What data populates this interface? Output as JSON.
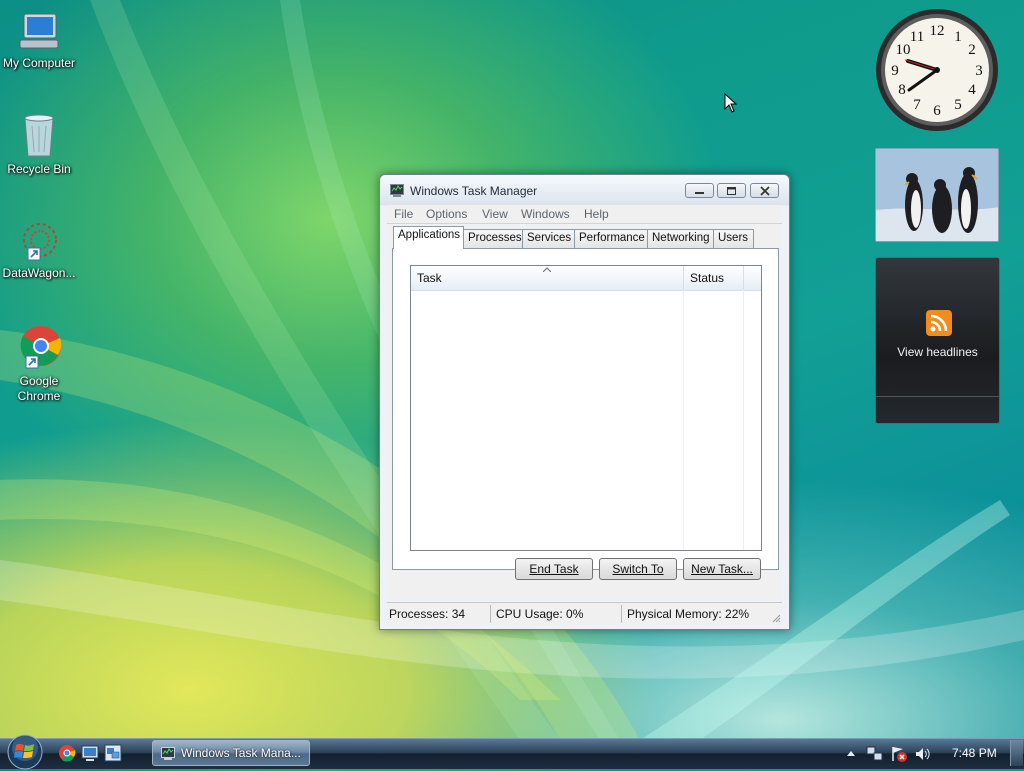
{
  "desktop": {
    "icons": [
      {
        "label": "My Computer"
      },
      {
        "label": "Recycle Bin"
      },
      {
        "label": "DataWagon..."
      },
      {
        "label": "Google Chrome"
      }
    ]
  },
  "task_manager": {
    "title": "Windows Task Manager",
    "menu": [
      "File",
      "Options",
      "View",
      "Windows",
      "Help"
    ],
    "tabs": [
      "Applications",
      "Processes",
      "Services",
      "Performance",
      "Networking",
      "Users"
    ],
    "active_tab": "Applications",
    "columns": [
      "Task",
      "Status"
    ],
    "buttons": {
      "end_task": "End Task",
      "switch_to": "Switch To",
      "new_task": "New Task..."
    },
    "status": {
      "processes": "Processes: 34",
      "cpu": "CPU Usage: 0%",
      "memory": "Physical Memory: 22%"
    }
  },
  "gadgets": {
    "clock_numbers": [
      "12",
      "1",
      "2",
      "3",
      "4",
      "5",
      "6",
      "7",
      "8",
      "9",
      "10",
      "11"
    ],
    "feed_label": "View headlines"
  },
  "taskbar": {
    "task_button": "Windows Task Mana...",
    "time": "7:48 PM"
  },
  "colors": {
    "accent": "#0c8f86",
    "taskbar": "#1d2e40"
  }
}
